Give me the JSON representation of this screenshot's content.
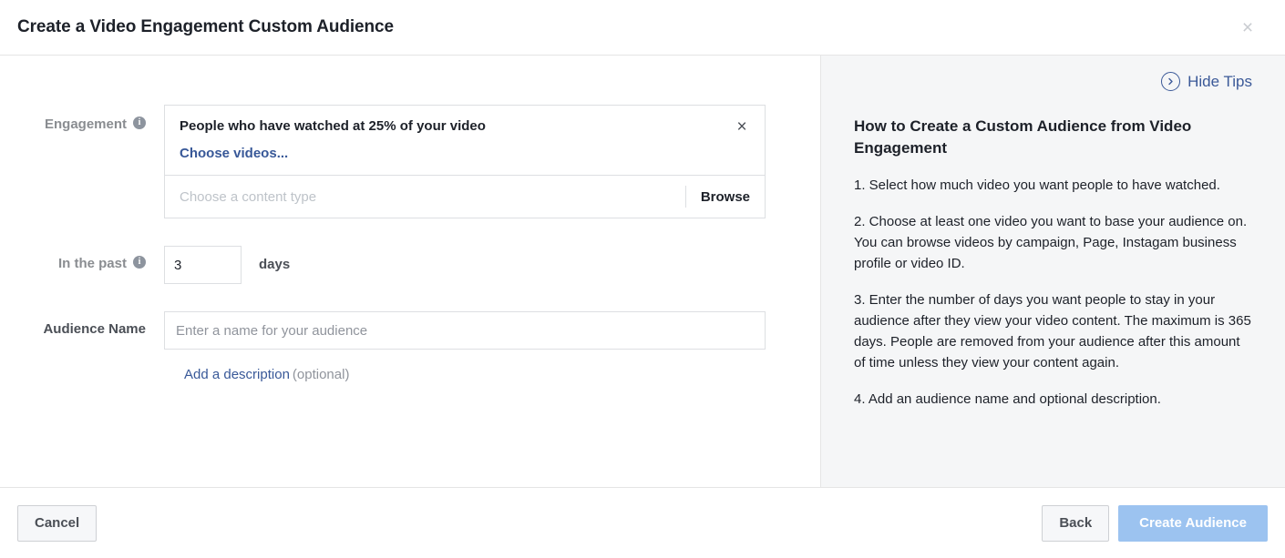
{
  "header": {
    "title": "Create a Video Engagement Custom Audience",
    "close_icon": "close-icon",
    "close_glyph": "×"
  },
  "form": {
    "engagement": {
      "label": "Engagement",
      "info_icon": "info-icon",
      "info_glyph": "i",
      "selected_option": "People who have watched at 25% of your video",
      "choose_videos_link": "Choose videos...",
      "remove_glyph": "×",
      "content_type_placeholder": "Choose a content type",
      "browse_label": "Browse"
    },
    "in_the_past": {
      "label": "In the past",
      "info_icon": "info-icon",
      "info_glyph": "i",
      "value": "3",
      "unit": "days"
    },
    "audience_name": {
      "label": "Audience Name",
      "value": "",
      "placeholder": "Enter a name for your audience"
    },
    "description": {
      "link": "Add a description",
      "optional": "(optional)"
    }
  },
  "tips": {
    "toggle_label": "Hide Tips",
    "toggle_icon": "chevron-right-circle-icon",
    "heading": "How to Create a Custom Audience from Video Engagement",
    "paragraphs": [
      "1. Select how much video you want people to have watched.",
      "2. Choose at least one video you want to base your audience on. You can browse videos by campaign, Page, Instagam business profile or video ID.",
      "3. Enter the number of days you want people to stay in your audience after they view your video content. The maximum is 365 days. People are removed from your audience after this amount of time unless they view your content again.",
      "4. Add an audience name and optional description."
    ]
  },
  "footer": {
    "cancel_label": "Cancel",
    "back_label": "Back",
    "create_label": "Create Audience"
  },
  "colors": {
    "link_blue": "#385898",
    "tips_blue": "#3b5998",
    "primary_disabled": "#9cc3f0",
    "panel_bg": "#f5f6f7",
    "border": "#dddfe2",
    "text_dark": "#1d2129",
    "text_muted": "#90949c"
  }
}
